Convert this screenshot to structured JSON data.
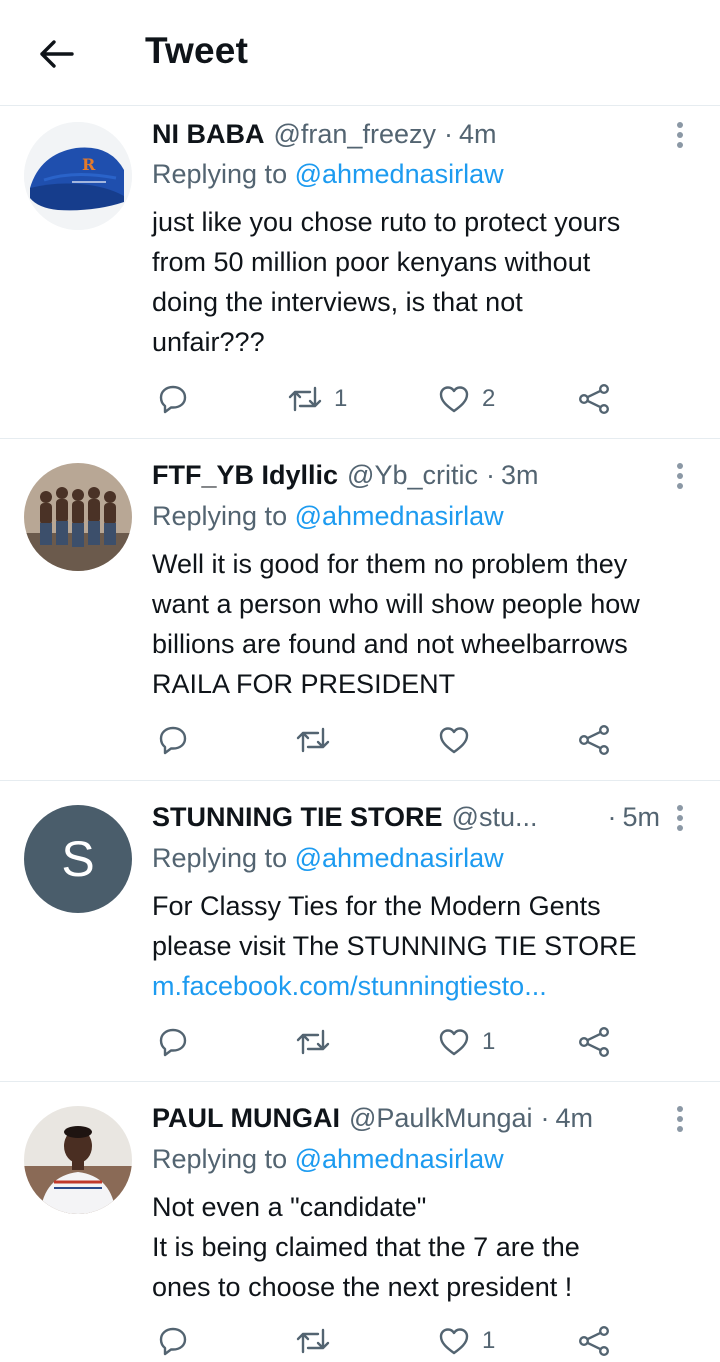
{
  "header": {
    "title": "Tweet",
    "back_icon": "arrow-left-icon"
  },
  "colors": {
    "link": "#1d9bf0",
    "secondary_text": "#536471",
    "divider": "#e6ecf0"
  },
  "tweets": [
    {
      "name": "NI BABA",
      "handle": "@fran_freezy",
      "separator": "·",
      "time": "4m",
      "reply_prefix": "Replying to",
      "reply_mention": "@ahmednasirlaw",
      "lines": [
        "just like you chose ruto to protect yours",
        "from 50 million poor kenyans without",
        "doing the interviews, is that not",
        "unfair???"
      ],
      "retweets": "1",
      "likes": "2"
    },
    {
      "name": "FTF_YB Idyllic",
      "handle": "@Yb_critic",
      "separator": "·",
      "time": "3m",
      "reply_prefix": "Replying to",
      "reply_mention": "@ahmednasirlaw",
      "lines": [
        "Well it is good for them no problem they",
        "want a person who will show people how",
        "billions are found and not wheelbarrows",
        "RAILA FOR PRESIDENT"
      ],
      "retweets": "",
      "likes": ""
    },
    {
      "name": "STUNNING TIE STORE",
      "handle": "@stu...",
      "separator": "·",
      "time": "5m",
      "avatar_letter": "S",
      "reply_prefix": "Replying to",
      "reply_mention": "@ahmednasirlaw",
      "lines": [
        "For Classy Ties for the Modern Gents",
        "please visit The STUNNING TIE STORE"
      ],
      "link": "m.facebook.com/stunningtiesto...",
      "retweets": "",
      "likes": "1"
    },
    {
      "name": "PAUL MUNGAI",
      "handle": "@PaulkMungai",
      "separator": "·",
      "time": "4m",
      "reply_prefix": "Replying to",
      "reply_mention": "@ahmednasirlaw",
      "lines": [
        "Not even a \"candidate\"",
        "It is being claimed that the 7 are the",
        "ones to choose the next president !"
      ],
      "retweets": "",
      "likes": "1"
    }
  ]
}
